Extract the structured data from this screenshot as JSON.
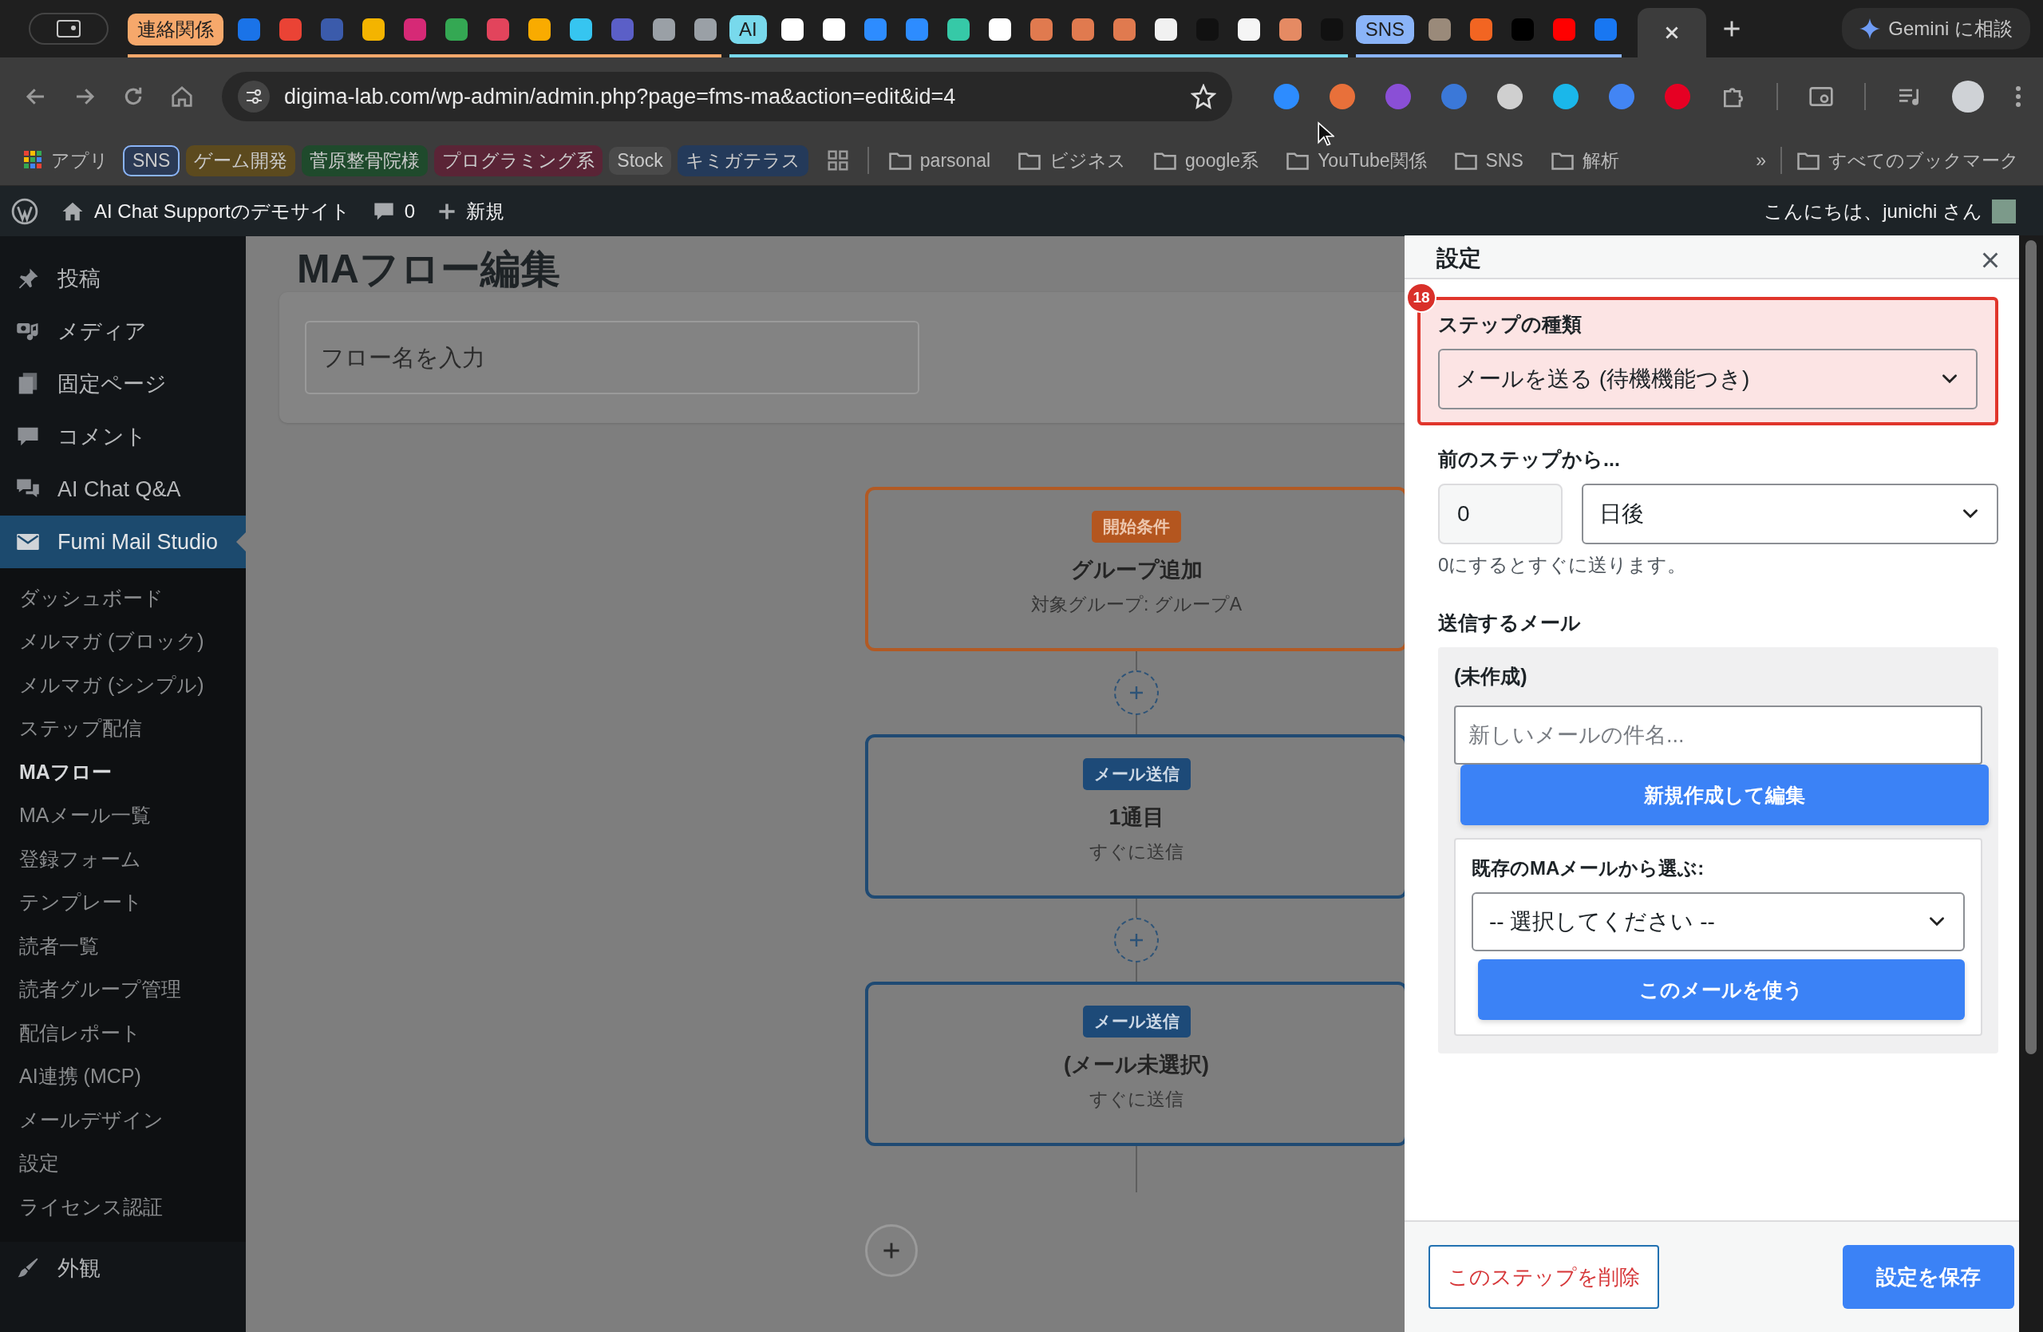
{
  "browser": {
    "tab_groups": [
      {
        "label": "連絡関係",
        "color": "#f6a86b",
        "tabs": [
          {
            "color": "#1a73e8",
            "selected": false
          },
          {
            "color": "#ea4335",
            "selected": false
          },
          {
            "color": "#3b5bab",
            "selected": false
          },
          {
            "color": "#f4b400",
            "selected": false
          },
          {
            "color": "#d62976",
            "selected": false
          },
          {
            "color": "#34a853",
            "selected": false
          },
          {
            "color": "#e2445c",
            "selected": false
          },
          {
            "color": "#f9ab00",
            "selected": false
          },
          {
            "color": "#36c5f0",
            "selected": false
          },
          {
            "color": "#5b5fc7",
            "selected": false
          },
          {
            "color": "#9aa0a6",
            "selected": false
          },
          {
            "color": "#9aa0a6",
            "selected": false
          }
        ]
      },
      {
        "label": "AI",
        "color": "#78d9ec",
        "tabs": [
          {
            "color": "#ffffff",
            "selected": false
          },
          {
            "color": "#ffffff",
            "selected": false
          },
          {
            "color": "#2d8cff",
            "selected": false
          },
          {
            "color": "#2d8cff",
            "selected": false
          },
          {
            "color": "#36c9a7",
            "selected": false
          },
          {
            "color": "#ffffff",
            "selected": false
          },
          {
            "color": "#e07a4f",
            "selected": false
          },
          {
            "color": "#e07a4f",
            "selected": false
          },
          {
            "color": "#e07a4f",
            "selected": false
          },
          {
            "color": "#f1f1f1",
            "selected": false
          },
          {
            "color": "#111111",
            "selected": false
          },
          {
            "color": "#f5f5f5",
            "selected": false
          },
          {
            "color": "#e58a63",
            "selected": false
          },
          {
            "color": "#111111",
            "selected": false
          }
        ]
      },
      {
        "label": "SNS",
        "color": "#8ab4f8",
        "tabs": [
          {
            "color": "#9a8a7a",
            "selected": false
          },
          {
            "color": "#f26522",
            "selected": false
          },
          {
            "color": "#000000",
            "selected": false
          },
          {
            "color": "#ff0000",
            "selected": false
          },
          {
            "color": "#1877f2",
            "selected": false
          }
        ]
      }
    ],
    "tabs": [
      {
        "selected": true
      }
    ],
    "gemini": "Gemini に相談",
    "url": "digima-lab.com/wp-admin/admin.php?page=fms-ma&action=edit&id=4",
    "extensions": [
      {
        "color": "#2d8cff"
      },
      {
        "color": "#e8703a"
      },
      {
        "color": "#8a4fd6"
      },
      {
        "color": "#3b78d8"
      },
      {
        "color": "#cfcfcf"
      },
      {
        "color": "#1ab7ea"
      },
      {
        "color": "#4285f4"
      },
      {
        "color": "#e60023"
      }
    ],
    "bookmarks": [
      {
        "kind": "apps",
        "label": "アプリ"
      },
      {
        "kind": "group",
        "label": "SNS",
        "color": "#8ab4f8"
      },
      {
        "kind": "group",
        "label": "ゲーム開発",
        "color": "#5c4a1e"
      },
      {
        "kind": "group",
        "label": "菅原整骨院様",
        "color": "#1f4a2c"
      },
      {
        "kind": "group",
        "label": "プログラミング系",
        "color": "#5a2436"
      },
      {
        "kind": "group",
        "label": "Stock",
        "color": "#4a4a4a"
      },
      {
        "kind": "group",
        "label": "キミガテラス",
        "color": "#243a5a"
      },
      {
        "kind": "grid"
      },
      {
        "kind": "folder",
        "label": "parsonal"
      },
      {
        "kind": "folder",
        "label": "ビジネス"
      },
      {
        "kind": "folder",
        "label": "google系"
      },
      {
        "kind": "folder",
        "label": "YouTube関係"
      },
      {
        "kind": "folder",
        "label": "SNS"
      },
      {
        "kind": "folder",
        "label": "解析"
      }
    ],
    "more": "»",
    "all_bookmarks": "すべてのブックマーク"
  },
  "admin_bar": {
    "site": "AI Chat Supportのデモサイト",
    "comments": "0",
    "new": "新規",
    "greeting": "こんにちは、junichi さん"
  },
  "sidebar": {
    "items": [
      {
        "label": "投稿",
        "selected": false
      },
      {
        "label": "メディア",
        "selected": false
      },
      {
        "label": "固定ページ",
        "selected": false
      },
      {
        "label": "コメント",
        "selected": false
      },
      {
        "label": "AI Chat Q&A",
        "selected": false
      },
      {
        "label": "Fumi Mail Studio",
        "selected": true,
        "children": [
          {
            "label": "ダッシュボード",
            "selected": false
          },
          {
            "label": "メルマガ (ブロック)",
            "selected": false
          },
          {
            "label": "メルマガ (シンプル)",
            "selected": false
          },
          {
            "label": "ステップ配信",
            "selected": false
          },
          {
            "label": "MAフロー",
            "selected": true
          },
          {
            "label": "MAメール一覧",
            "selected": false
          },
          {
            "label": "登録フォーム",
            "selected": false
          },
          {
            "label": "テンプレート",
            "selected": false
          },
          {
            "label": "読者一覧",
            "selected": false
          },
          {
            "label": "読者グループ管理",
            "selected": false
          },
          {
            "label": "配信レポート",
            "selected": false
          },
          {
            "label": "AI連携 (MCP)",
            "selected": false
          },
          {
            "label": "メールデザイン",
            "selected": false
          },
          {
            "label": "設定",
            "selected": false
          },
          {
            "label": "ライセンス認証",
            "selected": false
          }
        ]
      },
      {
        "label": "外観",
        "selected": false
      }
    ]
  },
  "page": {
    "title": "MAフロー編集",
    "flow_name": {
      "placeholder": "フロー名を入力"
    },
    "nodes": [
      {
        "kind": "trigger",
        "badge": "開始条件",
        "title": "グループ追加",
        "detail": "対象グループ: グループA"
      },
      {
        "kind": "mail",
        "badge": "メール送信",
        "title": "1通目",
        "detail": "すぐに送信"
      },
      {
        "kind": "mail",
        "badge": "メール送信",
        "title": "(メール未選択)",
        "detail": "すぐに送信"
      }
    ]
  },
  "panel": {
    "title": "設定",
    "badge": "18",
    "step_type": {
      "label": "ステップの種類",
      "value": "メールを送る (待機機能つき)"
    },
    "delay": {
      "label": "前のステップから...",
      "value": "0",
      "unit": "日後",
      "help": "0にするとすぐに送ります。"
    },
    "mail": {
      "label": "送信するメール",
      "status": "(未作成)",
      "subject_placeholder": "新しいメールの件名...",
      "create_button": "新規作成して編集",
      "existing_label": "既存のMAメールから選ぶ:",
      "existing_value": "-- 選択してください --",
      "use_button": "このメールを使う"
    },
    "delete_button": "このステップを削除",
    "save_button": "設定を保存"
  }
}
